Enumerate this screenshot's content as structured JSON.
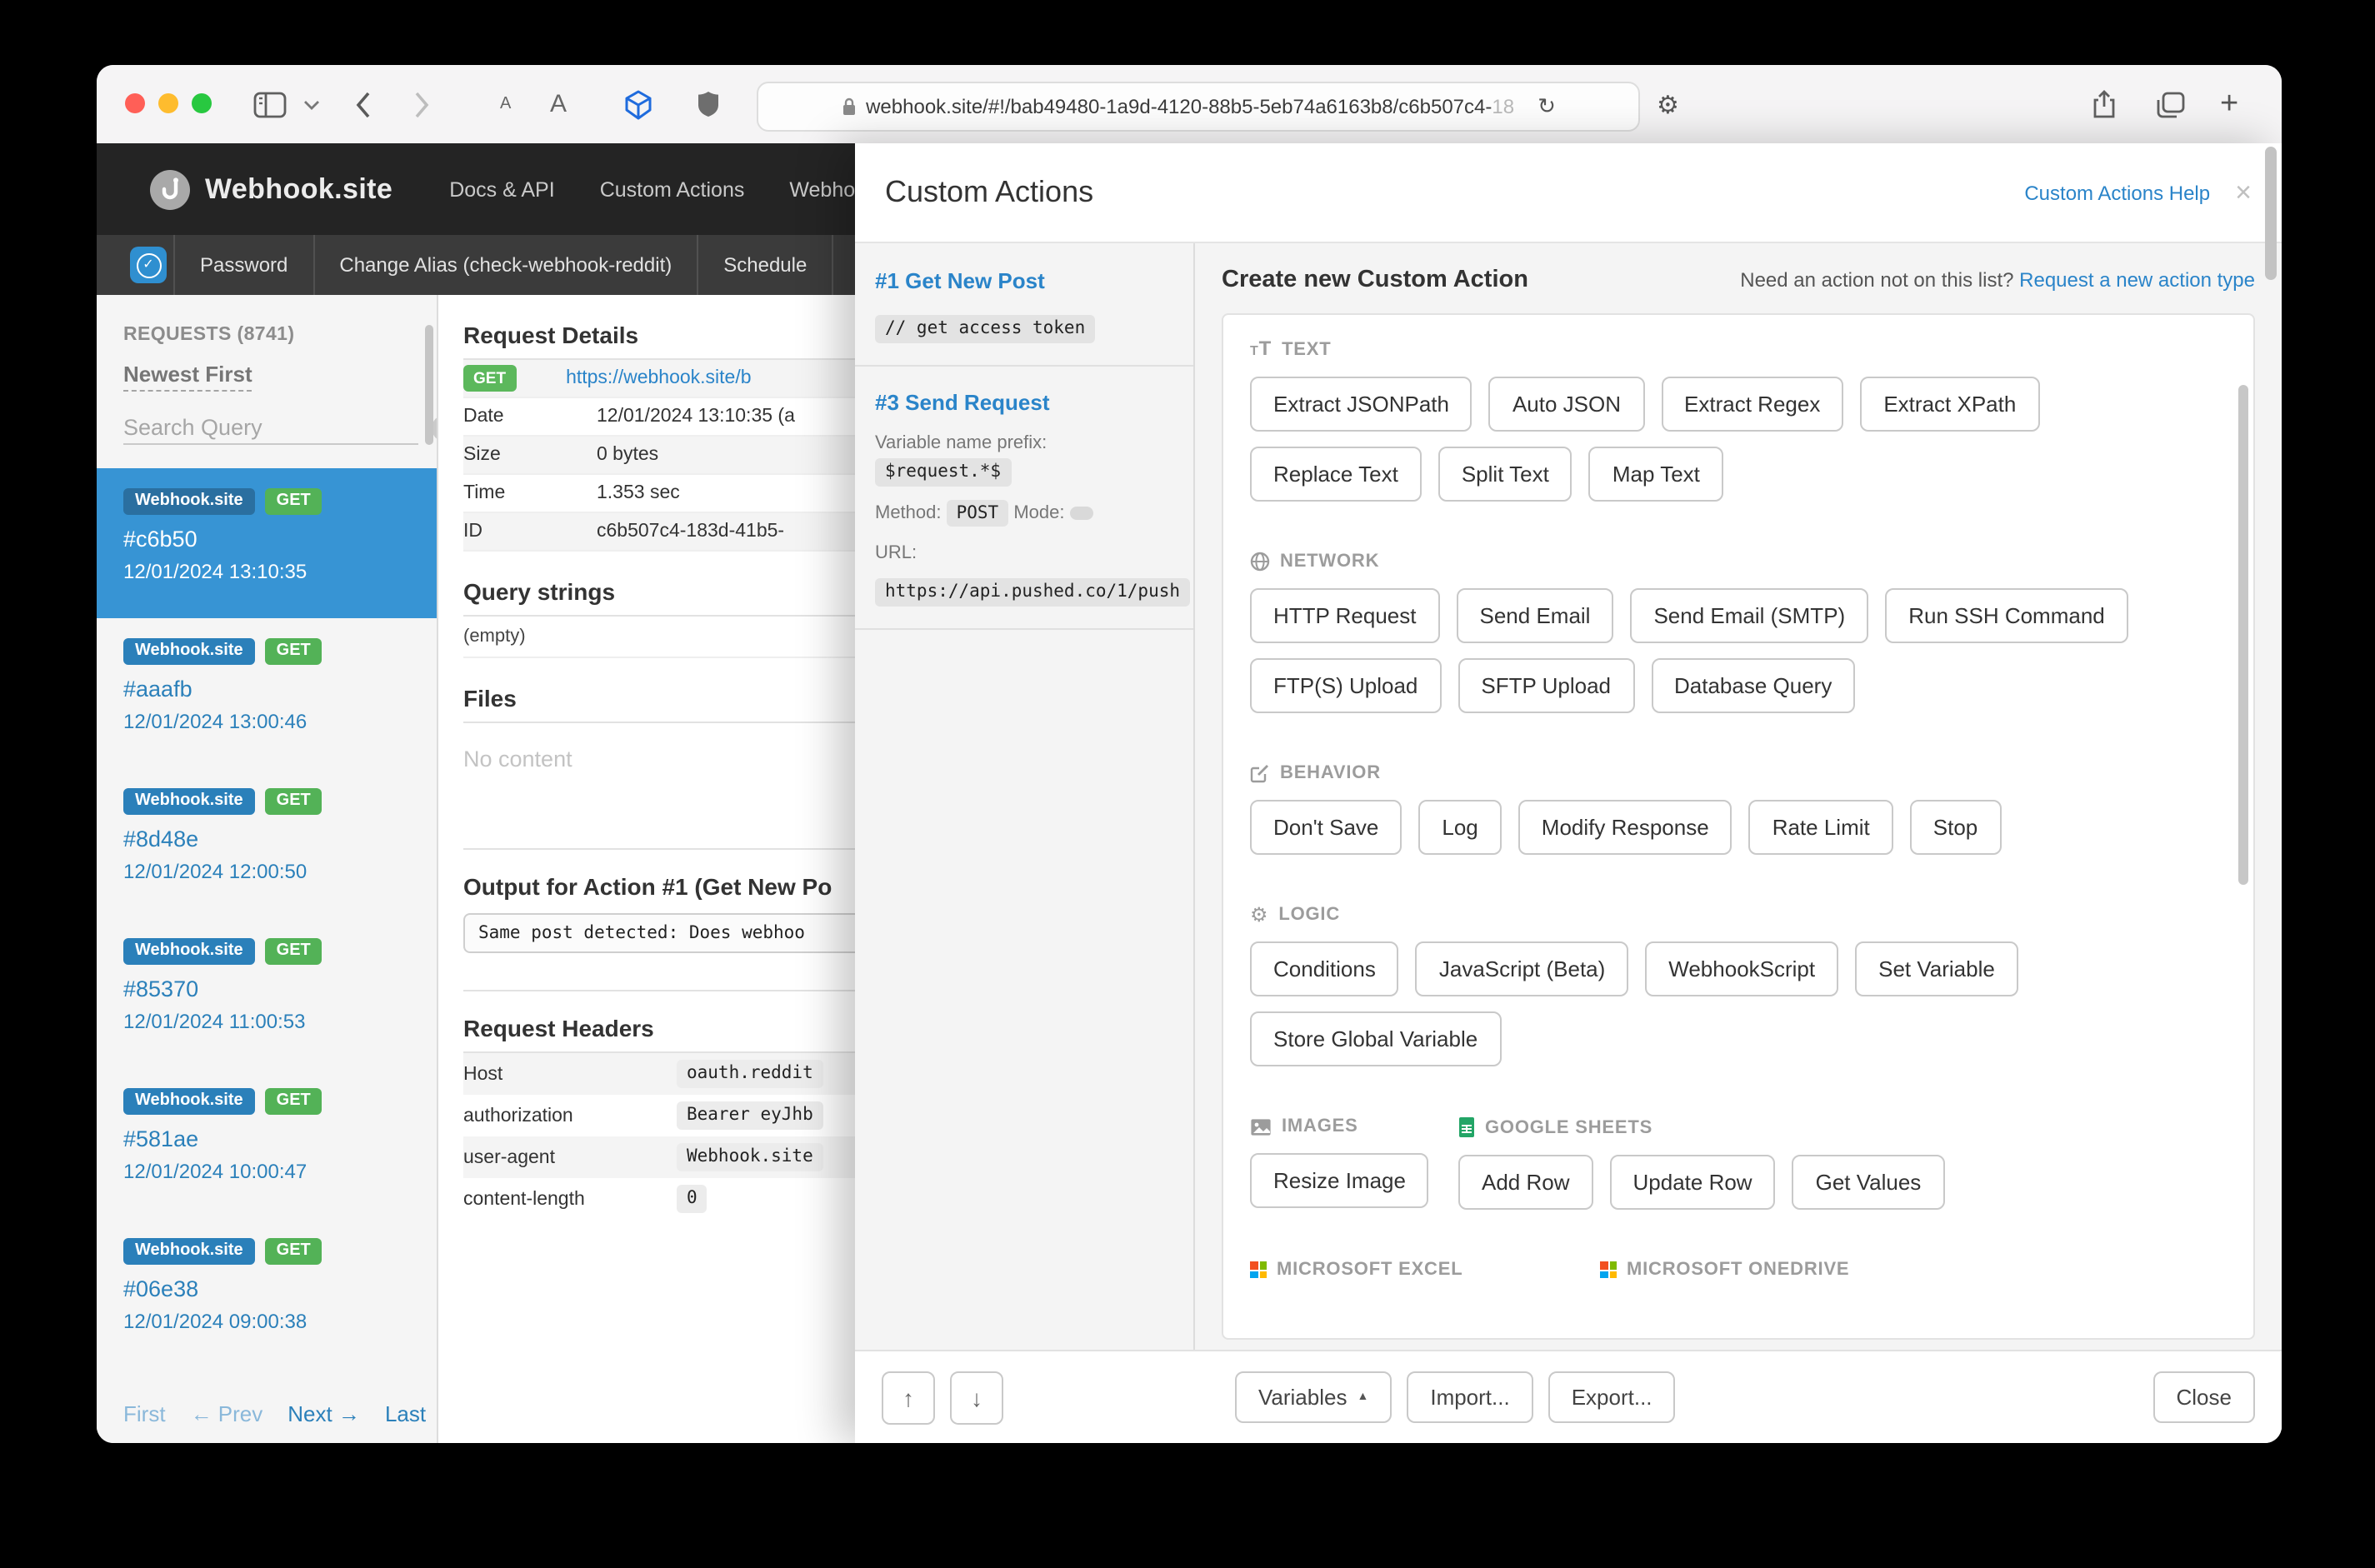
{
  "browser": {
    "url_main": "webhook.site/#!/bab49480-1a9d-4120-88b5-5eb74a6163b8/c6b507c4-",
    "url_faded": "18"
  },
  "nav": {
    "brand": "Webhook.site",
    "links": [
      "Docs & API",
      "Custom Actions",
      "WebhookScript"
    ],
    "sub_items": [
      "Password",
      "Change Alias (check-webhook-reddit)",
      "Schedule"
    ]
  },
  "sidebar": {
    "requests_label": "REQUESTS (8741)",
    "sort_label": "Newest First",
    "search_placeholder": "Search Query",
    "items": [
      {
        "source": "Webhook.site",
        "method": "GET",
        "hash": "#c6b50",
        "date": "12/01/2024 13:10:35",
        "selected": true
      },
      {
        "source": "Webhook.site",
        "method": "GET",
        "hash": "#aaafb",
        "date": "12/01/2024 13:00:46",
        "selected": false
      },
      {
        "source": "Webhook.site",
        "method": "GET",
        "hash": "#8d48e",
        "date": "12/01/2024 12:00:50",
        "selected": false
      },
      {
        "source": "Webhook.site",
        "method": "GET",
        "hash": "#85370",
        "date": "12/01/2024 11:00:53",
        "selected": false
      },
      {
        "source": "Webhook.site",
        "method": "GET",
        "hash": "#581ae",
        "date": "12/01/2024 10:00:47",
        "selected": false
      },
      {
        "source": "Webhook.site",
        "method": "GET",
        "hash": "#06e38",
        "date": "12/01/2024 09:00:38",
        "selected": false
      }
    ],
    "pagination": [
      {
        "label": "First",
        "enabled": false
      },
      {
        "label": "← Prev",
        "enabled": false
      },
      {
        "label": "Next →",
        "enabled": true
      },
      {
        "label": "Last",
        "enabled": true
      }
    ]
  },
  "details": {
    "title": "Request Details",
    "request_rows": [
      {
        "badge": "GET",
        "link": "https://webhook.site/b"
      },
      {
        "label": "Date",
        "value": "12/01/2024 13:10:35 (a"
      },
      {
        "label": "Size",
        "value": "0 bytes"
      },
      {
        "label": "Time",
        "value": "1.353 sec"
      },
      {
        "label": "ID",
        "value": "c6b507c4-183d-41b5-"
      }
    ],
    "query_title": "Query strings",
    "query_value": "(empty)",
    "files_title": "Files",
    "files_value": "No content",
    "output_title": "Output for Action #1 (Get New Po",
    "output_value": "Same post detected: Does webhoo",
    "headers_title": "Request Headers",
    "header_rows": [
      {
        "label": "Host",
        "value": "oauth.reddit"
      },
      {
        "label": "authorization",
        "value": "Bearer eyJhb"
      },
      {
        "label": "user-agent",
        "value": "Webhook.site"
      },
      {
        "label": "content-length",
        "value": "0"
      }
    ]
  },
  "modal": {
    "title": "Custom Actions",
    "help_link": "Custom Actions Help",
    "close_glyph": "×",
    "action1": {
      "title": "#1 Get New Post",
      "comment": "// get access token"
    },
    "action3": {
      "title": "#3 Send Request",
      "prefix_label": "Variable name prefix:",
      "prefix_value": "$request.*$",
      "method_label": "Method:",
      "method_value": "POST",
      "mode_label": "Mode:",
      "url_label": "URL:",
      "url_value": "https://api.pushed.co/1/push"
    },
    "create_heading": "Create new Custom Action",
    "need_text": "Need an action not on this list?",
    "request_link": "Request a new action type",
    "sections": [
      {
        "id": "text",
        "label": "TEXT",
        "icon": "text-icon",
        "buttons": [
          "Extract JSONPath",
          "Auto JSON",
          "Extract Regex",
          "Extract XPath",
          "Replace Text",
          "Split Text",
          "Map Text"
        ]
      },
      {
        "id": "network",
        "label": "NETWORK",
        "icon": "globe-icon",
        "buttons": [
          "HTTP Request",
          "Send Email",
          "Send Email (SMTP)",
          "Run SSH Command",
          "FTP(S) Upload",
          "SFTP Upload",
          "Database Query"
        ]
      },
      {
        "id": "behavior",
        "label": "BEHAVIOR",
        "icon": "edit-icon",
        "buttons": [
          "Don't Save",
          "Log",
          "Modify Response",
          "Rate Limit",
          "Stop"
        ]
      },
      {
        "id": "logic",
        "label": "LOGIC",
        "icon": "gear-icon",
        "buttons": [
          "Conditions",
          "JavaScript (Beta)",
          "WebhookScript",
          "Set Variable",
          "Store Global Variable"
        ]
      }
    ],
    "pair_sections": [
      {
        "id": "images",
        "label": "IMAGES",
        "icon": "image-icon",
        "buttons": [
          "Resize Image"
        ]
      },
      {
        "id": "sheets",
        "label": "GOOGLE SHEETS",
        "icon": "sheets-icon",
        "buttons": [
          "Add Row",
          "Update Row",
          "Get Values"
        ]
      }
    ],
    "stub_sections": [
      {
        "id": "excel",
        "label": "MICROSOFT EXCEL",
        "icon": "microsoft-icon"
      },
      {
        "id": "onedrive",
        "label": "MICROSOFT ONEDRIVE",
        "icon": "microsoft-icon"
      }
    ],
    "footer": {
      "move_up_glyph": "↑",
      "move_down_glyph": "↓",
      "variables_label": "Variables",
      "variables_caret": "▲",
      "import_label": "Import...",
      "export_label": "Export...",
      "close_label": "Close"
    }
  }
}
